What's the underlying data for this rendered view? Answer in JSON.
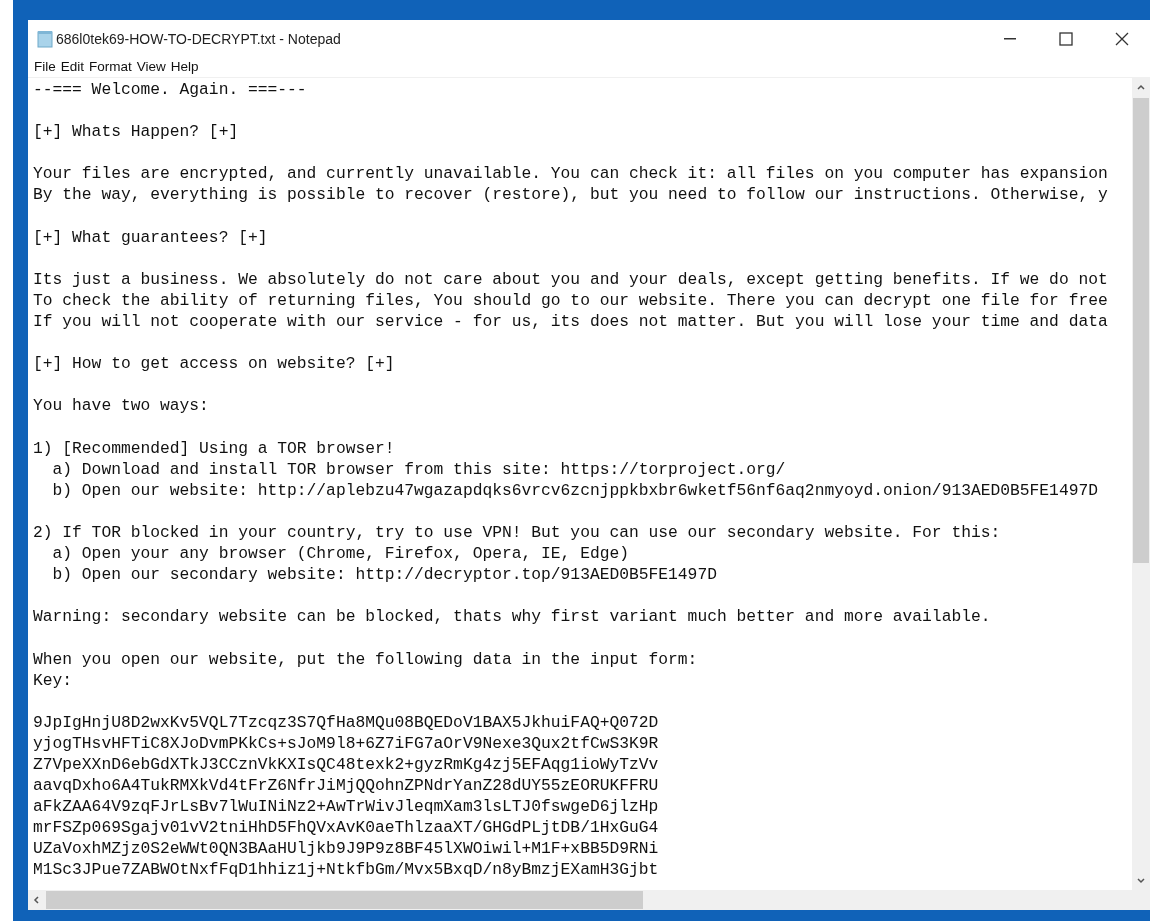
{
  "window": {
    "title": "686l0tek69-HOW-TO-DECRYPT.txt - Notepad"
  },
  "menu": [
    {
      "label": "File"
    },
    {
      "label": "Edit"
    },
    {
      "label": "Format"
    },
    {
      "label": "View"
    },
    {
      "label": "Help"
    }
  ],
  "document": {
    "paragraphs": [
      [
        "--=== Welcome. Again. ===---"
      ],
      [
        "[+] Whats Happen? [+]"
      ],
      [
        "Your files are encrypted, and currently unavailable. You can check it: all files on you computer has expansion",
        "By the way, everything is possible to recover (restore), but you need to follow our instructions. Otherwise, y"
      ],
      [
        "[+] What guarantees? [+]"
      ],
      [
        "Its just a business. We absolutely do not care about you and your deals, except getting benefits. If we do not",
        "To check the ability of returning files, You should go to our website. There you can decrypt one file for free",
        "If you will not cooperate with our service - for us, its does not matter. But you will lose your time and data"
      ],
      [
        "[+] How to get access on website? [+]"
      ],
      [
        "You have two ways:"
      ],
      [
        "1) [Recommended] Using a TOR browser!",
        "  a) Download and install TOR browser from this site: https://torproject.org/",
        "  b) Open our website: http://aplebzu47wgazapdqks6vrcv6zcnjppkbxbr6wketf56nf6aq2nmyoyd.onion/913AED0B5FE1497D"
      ],
      [
        "2) If TOR blocked in your country, try to use VPN! But you can use our secondary website. For this:",
        "  a) Open your any browser (Chrome, Firefox, Opera, IE, Edge)",
        "  b) Open our secondary website: http://decryptor.top/913AED0B5FE1497D"
      ],
      [
        "Warning: secondary website can be blocked, thats why first variant much better and more available."
      ],
      [
        "When you open our website, put the following data in the input form:",
        "Key:"
      ],
      [
        "9JpIgHnjU8D2wxKv5VQL7Tzcqz3S7QfHa8MQu08BQEDoV1BAX5JkhuiFAQ+Q072D",
        "yjogTHsvHFTiC8XJoDvmPKkCs+sJoM9l8+6Z7iFG7aOrV9Nexe3Qux2tfCwS3K9R",
        "Z7VpeXXnD6ebGdXTkJ3CCznVkKXIsQC48texk2+gyzRmKg4zj5EFAqg1ioWyTzVv",
        "aavqDxho6A4TukRMXkVd4tFrZ6NfrJiMjQQohnZPNdrYanZ28dUY55zEORUKFFRU",
        "aFkZAA64V9zqFJrLsBv7lWuINiNz2+AwTrWivJleqmXam3lsLTJ0fswgeD6jlzHp",
        "mrFSZp069Sgajv01vV2tniHhD5FhQVxAvK0aeThlzaaXT/GHGdPLjtDB/1HxGuG4",
        "UZaVoxhMZjz0S2eWWt0QN3BAaHUljkb9J9P9z8BF45lXWOiwil+M1F+xBB5D9RNi",
        "M1Sc3JPue7ZABWOtNxfFqD1hhiz1j+NtkfbGm/Mvx5BxqD/n8yBmzjEXamH3Gjbt"
      ]
    ]
  }
}
